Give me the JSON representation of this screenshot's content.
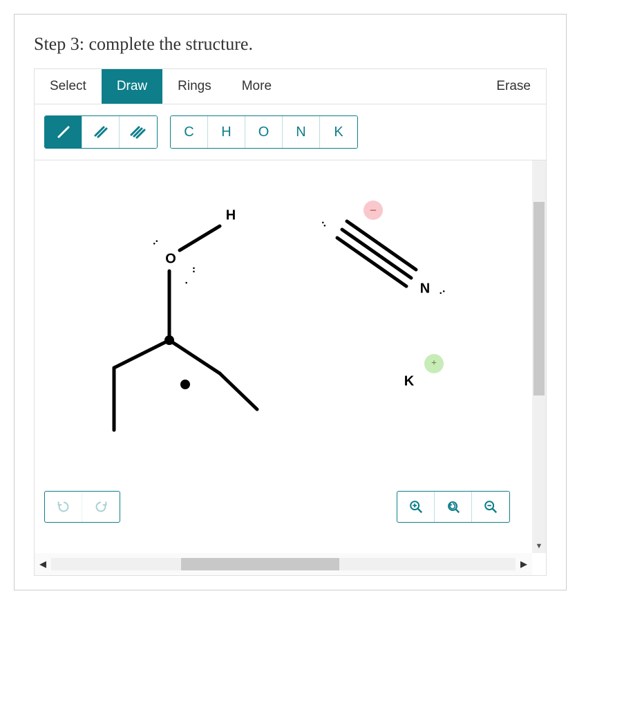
{
  "instruction": "Step 3: complete the structure.",
  "tabs": {
    "select": "Select",
    "draw": "Draw",
    "rings": "Rings",
    "more": "More",
    "erase": "Erase",
    "active": "draw"
  },
  "bond_tools": {
    "single": "/",
    "double": "//",
    "triple": "///",
    "active": "single"
  },
  "element_tools": [
    "C",
    "H",
    "O",
    "N",
    "K"
  ],
  "canvas": {
    "atoms": {
      "H": "H",
      "O": "O",
      "N": "N",
      "K": "K"
    },
    "charges": {
      "minus": "−",
      "plus": "+"
    }
  },
  "controls": {
    "undo": "undo",
    "redo": "redo",
    "zoom_in": "zoom-in",
    "zoom_reset": "zoom-reset",
    "zoom_out": "zoom-out"
  },
  "colors": {
    "accent": "#0d7e8a"
  }
}
